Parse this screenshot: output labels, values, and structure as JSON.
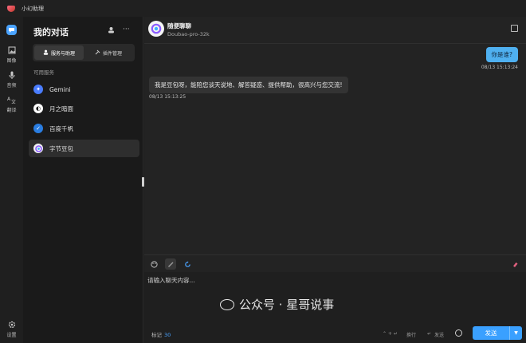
{
  "app": {
    "title": "小幻助理"
  },
  "nav": {
    "items": [
      {
        "label": "",
        "icon": "chat-icon"
      },
      {
        "label": "图像",
        "icon": "image-icon"
      },
      {
        "label": "音频",
        "icon": "microphone-icon"
      },
      {
        "label": "翻译",
        "icon": "translate-icon"
      }
    ],
    "settings_label": "设置"
  },
  "sidebar": {
    "title": "我的对话",
    "tabs": [
      {
        "label": "服务与助理",
        "active": true
      },
      {
        "label": "插件管理",
        "active": false
      }
    ],
    "section_label": "可用服务",
    "services": [
      {
        "name": "Gemini",
        "icon": "gemini-icon",
        "color": "#4a7dff"
      },
      {
        "name": "月之暗面",
        "icon": "moonshot-icon",
        "color": "#ffffff"
      },
      {
        "name": "百度千帆",
        "icon": "qianfan-icon",
        "color": "#2a7de1"
      },
      {
        "name": "字节豆包",
        "icon": "doubao-icon",
        "color": "#8a5cff",
        "active": true
      }
    ]
  },
  "chat": {
    "bot_name": "随便聊聊",
    "model": "Doubao-pro-32k",
    "messages": [
      {
        "role": "user",
        "text": "你是谁?",
        "time": "08/13 15:13:24"
      },
      {
        "role": "assistant",
        "text": "我是豆包呀，能陪您谈天说地、解答疑惑、提供帮助，很高兴与您交流!",
        "time": "08/13 15:13:25"
      }
    ],
    "input_placeholder": "请输入聊天内容..."
  },
  "footer": {
    "token_label": "标记",
    "token_count": "30",
    "newline_hint": "换行",
    "newline_keys": "⌃ + ↵",
    "send_hint": "发送",
    "send_label": "发送"
  },
  "watermark": {
    "text": "公众号 · 星哥说事"
  },
  "colors": {
    "accent": "#3aa0ff",
    "user_bubble": "#4fb0f0"
  }
}
